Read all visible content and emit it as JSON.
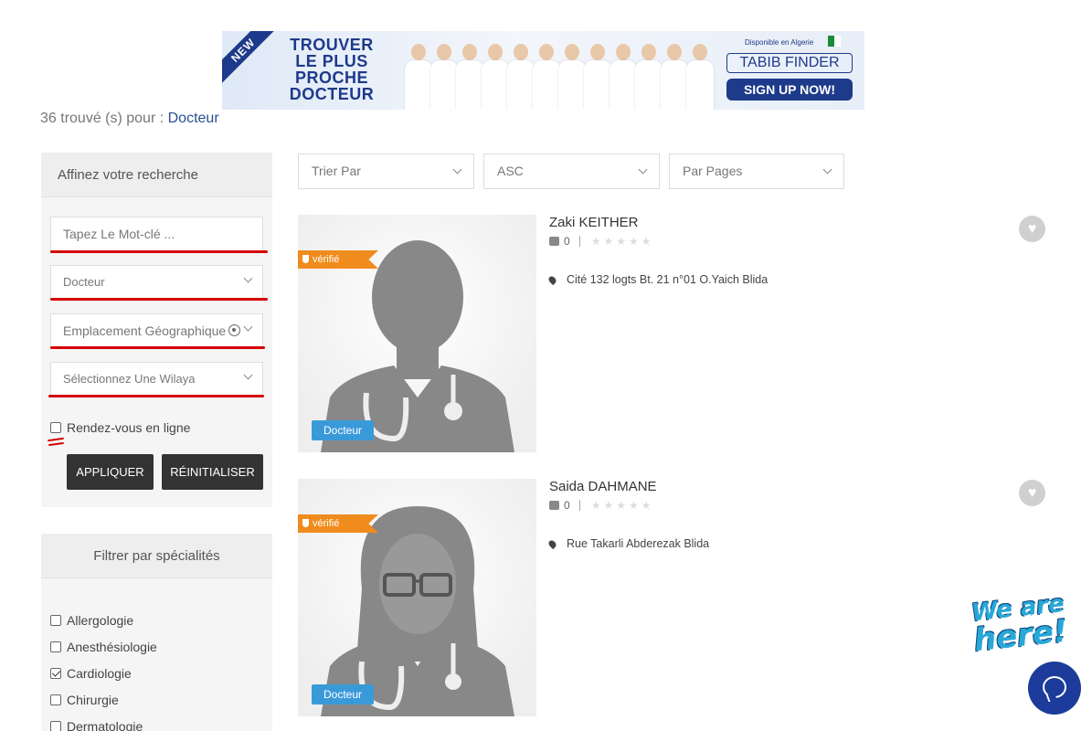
{
  "banner": {
    "ribbon": "NEW",
    "headline": "TROUVER LE PLUS PROCHE DOCTEUR",
    "availability": "Disponible en Algerie",
    "brand": "TABIB FINDER",
    "cta": "SIGN UP NOW!"
  },
  "results": {
    "count_text": "36 trouvé (s) pour :",
    "term": "Docteur"
  },
  "search_panel": {
    "title": "Affinez votre recherche",
    "keyword_placeholder": "Tapez Le Mot-clé ...",
    "category_value": "Docteur",
    "location_placeholder": "Emplacement Géographique",
    "wilaya_value": "Sélectionnez Une Wilaya",
    "online_label": "Rendez-vous en ligne",
    "apply_label": "APPLIQUER",
    "reset_label": "RÉINITIALISER"
  },
  "specialties_panel": {
    "title": "Filtrer par spécialités",
    "items": [
      {
        "label": "Allergologie",
        "checked": false
      },
      {
        "label": "Anesthésiologie",
        "checked": false
      },
      {
        "label": "Cardiologie",
        "checked": true
      },
      {
        "label": "Chirurgie",
        "checked": false
      },
      {
        "label": "Dermatologie",
        "checked": false
      }
    ]
  },
  "sort_bar": {
    "sort_by": "Trier Par",
    "order": "ASC",
    "per_page": "Par Pages"
  },
  "listings": [
    {
      "verified_label": "vérifié",
      "category": "Docteur",
      "name": "Zaki KEITHER",
      "likes": "0",
      "rating": 0,
      "address": "Cité 132 logts Bt. 21 n°01 O.Yaich Blida"
    },
    {
      "verified_label": "vérifié",
      "category": "Docteur",
      "name": "Saida DAHMANE",
      "likes": "0",
      "rating": 0,
      "address": "Rue Takarli Abderezak Blida"
    }
  ],
  "chat_widget": {
    "line1": "We are",
    "line2": "here!"
  },
  "colors": {
    "accent_blue": "#2a4f8f",
    "verified_orange": "#f08c1e",
    "category_blue": "#3a9ad9",
    "annotation_red": "#d40000",
    "chat_blue": "#1c3b9a"
  }
}
